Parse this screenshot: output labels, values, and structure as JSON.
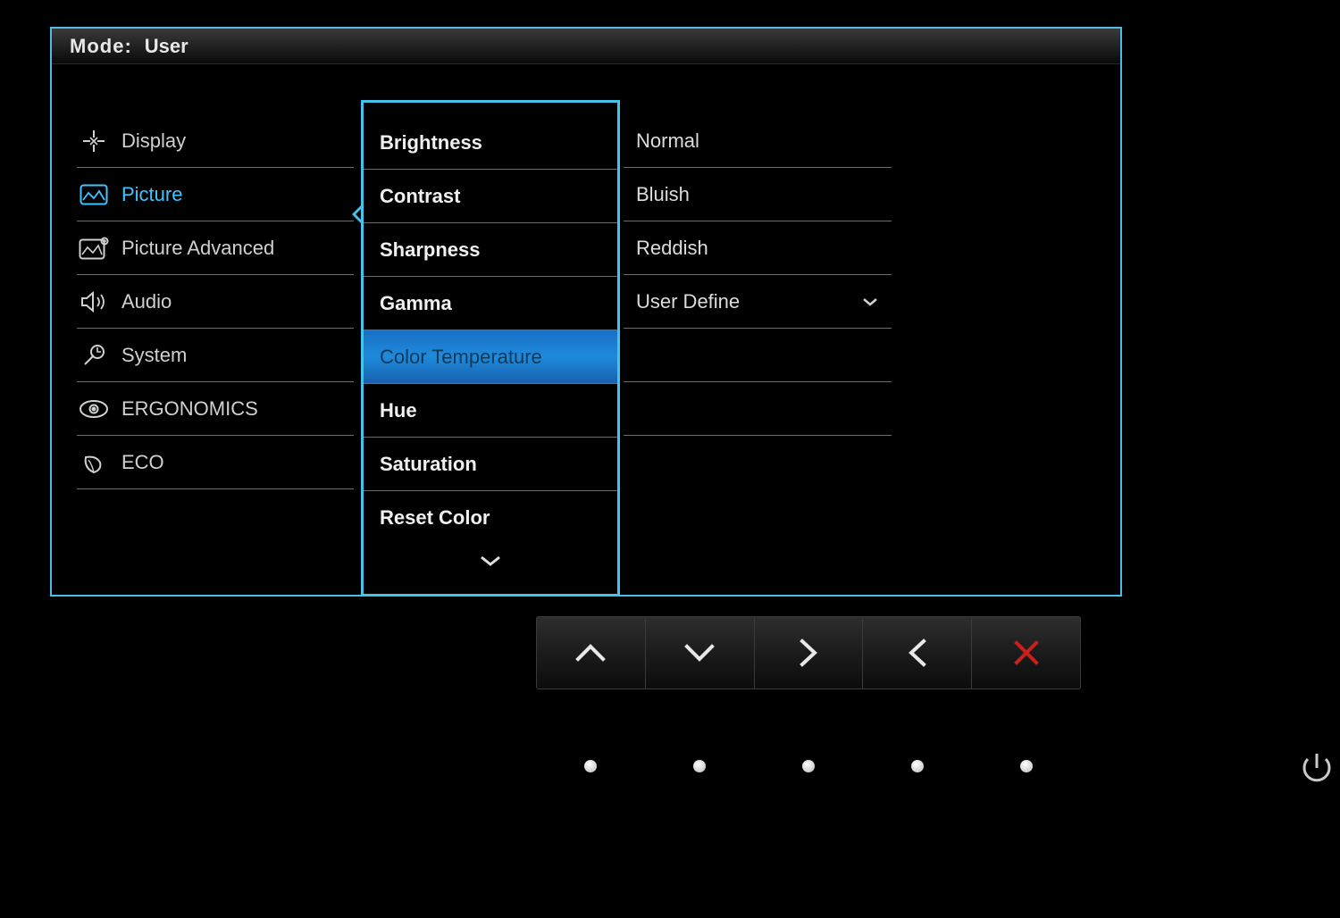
{
  "header": {
    "mode_label": "Mode:",
    "mode_value": "User"
  },
  "main_menu": [
    {
      "id": "display",
      "label": "Display",
      "icon": "display-icon",
      "selected": false
    },
    {
      "id": "picture",
      "label": "Picture",
      "icon": "picture-icon",
      "selected": true
    },
    {
      "id": "picture-advanced",
      "label": "Picture Advanced",
      "icon": "picture-advanced-icon",
      "selected": false
    },
    {
      "id": "audio",
      "label": "Audio",
      "icon": "audio-icon",
      "selected": false
    },
    {
      "id": "system",
      "label": "System",
      "icon": "system-icon",
      "selected": false
    },
    {
      "id": "ergonomics",
      "label": "ERGONOMICS",
      "icon": "ergonomics-icon",
      "selected": false
    },
    {
      "id": "eco",
      "label": "ECO",
      "icon": "eco-icon",
      "selected": false
    }
  ],
  "sub_menu": [
    {
      "label": "Brightness",
      "highlighted": false
    },
    {
      "label": "Contrast",
      "highlighted": false
    },
    {
      "label": "Sharpness",
      "highlighted": false
    },
    {
      "label": "Gamma",
      "highlighted": false
    },
    {
      "label": "Color Temperature",
      "highlighted": true
    },
    {
      "label": "Hue",
      "highlighted": false
    },
    {
      "label": "Saturation",
      "highlighted": false
    },
    {
      "label": "Reset Color",
      "highlighted": false
    }
  ],
  "options": [
    {
      "label": "Normal",
      "has_chevron": false
    },
    {
      "label": "Bluish",
      "has_chevron": false
    },
    {
      "label": "Reddish",
      "has_chevron": false
    },
    {
      "label": "User Define",
      "has_chevron": true
    },
    {
      "label": "",
      "has_chevron": false
    },
    {
      "label": "",
      "has_chevron": false
    }
  ],
  "nav_buttons": [
    {
      "name": "nav-up",
      "glyph": "up"
    },
    {
      "name": "nav-down",
      "glyph": "down"
    },
    {
      "name": "nav-right",
      "glyph": "right"
    },
    {
      "name": "nav-left",
      "glyph": "left"
    },
    {
      "name": "nav-cancel",
      "glyph": "close"
    }
  ],
  "colors": {
    "accent": "#46c3ea",
    "highlight_bg": "#1e8adc",
    "cancel": "#c81f1f"
  }
}
